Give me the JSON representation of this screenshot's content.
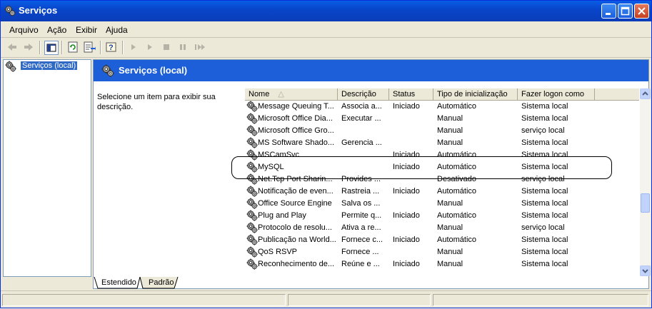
{
  "window": {
    "title": "Serviços"
  },
  "menu": [
    "Arquivo",
    "Ação",
    "Exibir",
    "Ajuda"
  ],
  "tree": {
    "root_label": "Serviços (local)"
  },
  "banner": {
    "title": "Serviços (local)"
  },
  "description": "Selecione um item para exibir sua descrição.",
  "columns": [
    "Nome",
    "Descrição",
    "Status",
    "Tipo de inicialização",
    "Fazer logon como"
  ],
  "rows": [
    {
      "name": "Message Queuing T...",
      "desc": "Associa a...",
      "status": "Iniciado",
      "startup": "Automático",
      "logon": "Sistema local"
    },
    {
      "name": "Microsoft Office Dia...",
      "desc": "Executar ...",
      "status": "",
      "startup": "Manual",
      "logon": "Sistema local"
    },
    {
      "name": "Microsoft Office Gro...",
      "desc": "",
      "status": "",
      "startup": "Manual",
      "logon": "serviço local"
    },
    {
      "name": "MS Software Shado...",
      "desc": "Gerencia ...",
      "status": "",
      "startup": "Manual",
      "logon": "Sistema local"
    },
    {
      "name": "MSCamSvc",
      "desc": "",
      "status": "Iniciado",
      "startup": "Automático",
      "logon": "Sistema local"
    },
    {
      "name": "MySQL",
      "desc": "",
      "status": "Iniciado",
      "startup": "Automático",
      "logon": "Sistema local"
    },
    {
      "name": "Net.Tcp Port Sharin...",
      "desc": "Provides ...",
      "status": "",
      "startup": "Desativado",
      "logon": "serviço local"
    },
    {
      "name": "Notificação de even...",
      "desc": "Rastreia ...",
      "status": "Iniciado",
      "startup": "Automático",
      "logon": "Sistema local"
    },
    {
      "name": "Office Source Engine",
      "desc": "Salva os ...",
      "status": "",
      "startup": "Manual",
      "logon": "Sistema local"
    },
    {
      "name": "Plug and Play",
      "desc": "Permite q...",
      "status": "Iniciado",
      "startup": "Automático",
      "logon": "Sistema local"
    },
    {
      "name": "Protocolo de resolu...",
      "desc": "Ativa a re...",
      "status": "",
      "startup": "Manual",
      "logon": "serviço local"
    },
    {
      "name": "Publicação na World...",
      "desc": "Fornece c...",
      "status": "Iniciado",
      "startup": "Automático",
      "logon": "Sistema local"
    },
    {
      "name": "QoS RSVP",
      "desc": "Fornece ...",
      "status": "",
      "startup": "Manual",
      "logon": "Sistema local"
    },
    {
      "name": "Reconhecimento de...",
      "desc": "Reúne e ...",
      "status": "Iniciado",
      "startup": "Manual",
      "logon": "Sistema local"
    }
  ],
  "tabs": [
    "Estendido",
    "Padrão"
  ],
  "colors": {
    "titlebar": "#0a4fd8",
    "banner": "#1d5fd8",
    "selection": "#316ac5",
    "chrome": "#ece9d8"
  },
  "icons": [
    "back-arrow-icon",
    "forward-arrow-icon",
    "show-hide-tree-icon",
    "refresh-icon",
    "export-list-icon",
    "help-icon",
    "play-icon",
    "play-alt-icon",
    "stop-icon",
    "pause-icon",
    "restart-icon",
    "gear-icon"
  ]
}
